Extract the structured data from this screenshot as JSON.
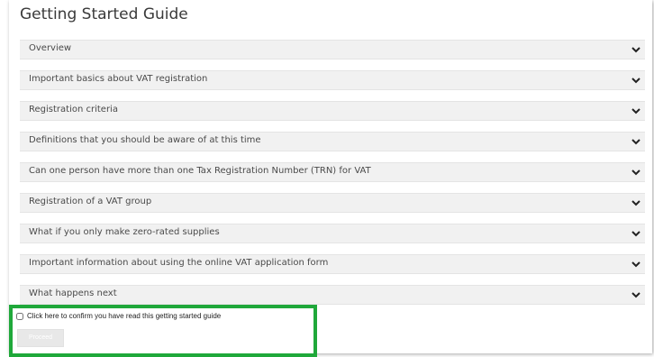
{
  "page": {
    "title": "Getting Started Guide"
  },
  "accordion": {
    "items": [
      {
        "label": "Overview"
      },
      {
        "label": "Important basics about VAT registration"
      },
      {
        "label": "Registration criteria"
      },
      {
        "label": "Definitions that you should be aware of at this time"
      },
      {
        "label": "Can one person have more than one Tax Registration Number (TRN) for VAT"
      },
      {
        "label": "Registration of a VAT group"
      },
      {
        "label": "What if you only make zero-rated supplies"
      },
      {
        "label": "Important information about using the online VAT application form"
      },
      {
        "label": "What happens next"
      }
    ],
    "icon": "chevron-down-icon"
  },
  "confirm": {
    "label": "Click here to confirm you have read this getting started guide",
    "checked": false
  },
  "proceed": {
    "label": "Proceed",
    "disabled": true
  },
  "colors": {
    "highlight_border": "#1fa83a",
    "item_background": "#f1f1f1"
  }
}
